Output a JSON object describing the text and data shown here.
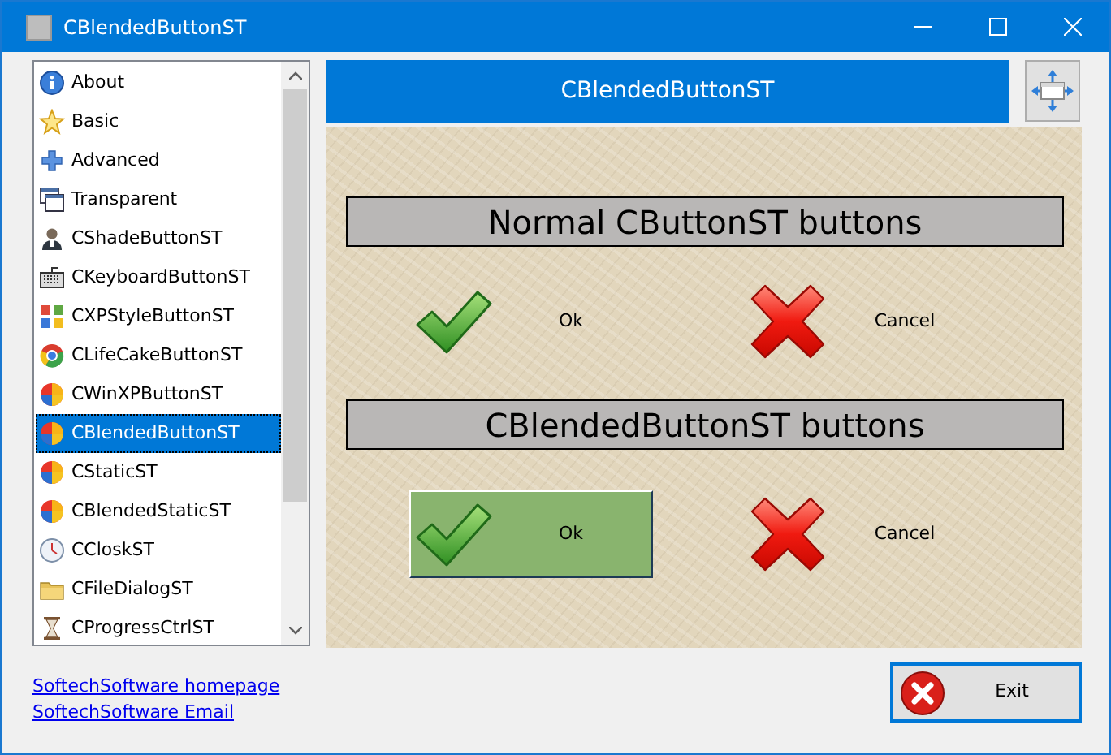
{
  "window": {
    "title": "CBlendedButtonST"
  },
  "sidebar": {
    "items": [
      {
        "label": "About",
        "kind": "info",
        "selected": false
      },
      {
        "label": "Basic",
        "kind": "star",
        "selected": false
      },
      {
        "label": "Advanced",
        "kind": "plus",
        "selected": false
      },
      {
        "label": "Transparent",
        "kind": "windows",
        "selected": false
      },
      {
        "label": "CShadeButtonST",
        "kind": "person",
        "selected": false
      },
      {
        "label": "CKeyboardButtonST",
        "kind": "keyboard",
        "selected": false
      },
      {
        "label": "CXPStyleButtonST",
        "kind": "tiles",
        "selected": false
      },
      {
        "label": "CLifeCakeButtonST",
        "kind": "ring",
        "selected": false
      },
      {
        "label": "CWinXPButtonST",
        "kind": "ball",
        "selected": false
      },
      {
        "label": "CBlendedButtonST",
        "kind": "ball",
        "selected": true
      },
      {
        "label": "CStaticST",
        "kind": "ball",
        "selected": false
      },
      {
        "label": "CBlendedStaticST",
        "kind": "ball",
        "selected": false
      },
      {
        "label": "CCloskST",
        "kind": "clock",
        "selected": false
      },
      {
        "label": "CFileDialogST",
        "kind": "folder",
        "selected": false
      },
      {
        "label": "CProgressCtrlST",
        "kind": "hourglass",
        "selected": false
      }
    ]
  },
  "links": [
    "SoftechSoftware homepage",
    "SoftechSoftware Email"
  ],
  "header": {
    "title": "CBlendedButtonST"
  },
  "sections": [
    {
      "title": "Normal CButtonST buttons",
      "buttons": [
        {
          "kind": "ok",
          "label": "Ok",
          "hovered": false
        },
        {
          "kind": "cancel",
          "label": "Cancel",
          "hovered": false
        }
      ]
    },
    {
      "title": "CBlendedButtonST buttons",
      "buttons": [
        {
          "kind": "ok",
          "label": "Ok",
          "hovered": true
        },
        {
          "kind": "cancel",
          "label": "Cancel",
          "hovered": false
        }
      ]
    }
  ],
  "exit_button": {
    "label": "Exit"
  }
}
